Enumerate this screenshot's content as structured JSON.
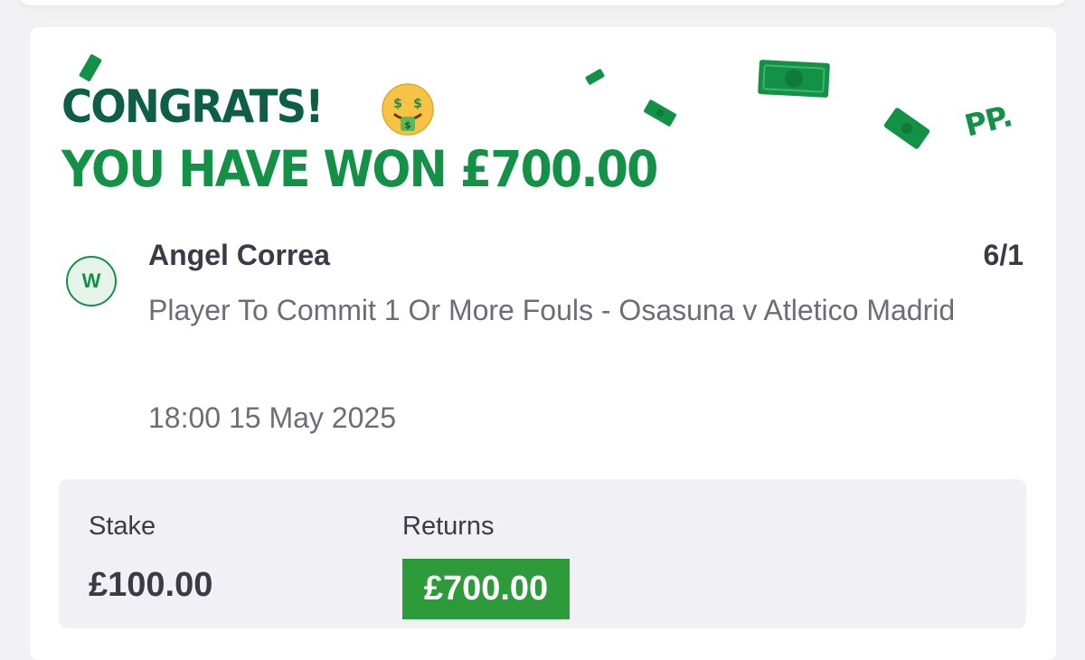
{
  "header": {
    "congrats": "CONGRATS!",
    "win_message": "YOU HAVE WON £700.00",
    "logo_text": "PP."
  },
  "selection": {
    "status": "W",
    "name": "Angel Correa",
    "odds": "6/1",
    "market": "Player To Commit 1 Or More Fouls - Osasuna v Atletico Madrid",
    "datetime": "18:00 15 May 2025"
  },
  "summary": {
    "stake_label": "Stake",
    "stake_value": "£100.00",
    "returns_label": "Returns",
    "returns_value": "£700.00"
  },
  "icons": {
    "emoji": "money-mouth-face-icon",
    "confetti": "money-banknote-icon"
  },
  "colors": {
    "brand_dark_green": "#0e5e46",
    "brand_green": "#139147",
    "returns_green": "#2d9b3a",
    "text_dark": "#3b3a47",
    "text_muted": "#6d6c77"
  }
}
